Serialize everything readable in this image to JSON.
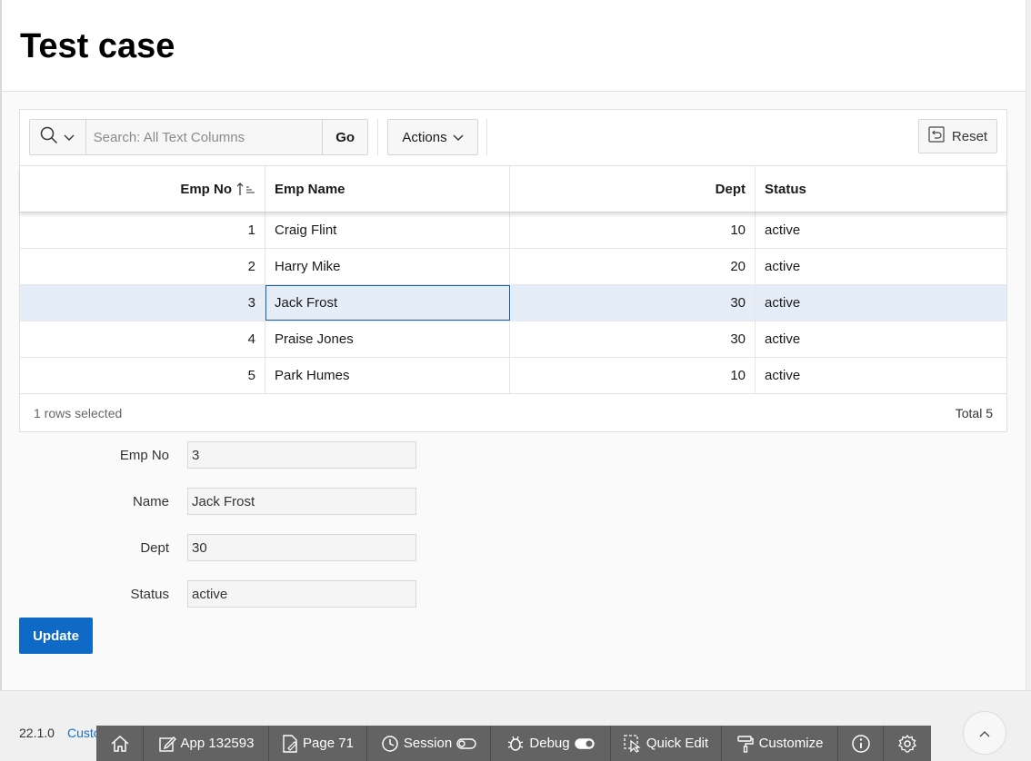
{
  "page": {
    "title": "Test case"
  },
  "toolbar": {
    "search_placeholder": "Search: All Text Columns",
    "go_label": "Go",
    "actions_label": "Actions",
    "reset_label": "Reset"
  },
  "grid": {
    "columns": [
      "Emp No",
      "Emp Name",
      "Dept",
      "Status"
    ],
    "rows": [
      {
        "emp_no": "1",
        "emp_name": "Craig Flint",
        "dept": "10",
        "status": "active"
      },
      {
        "emp_no": "2",
        "emp_name": "Harry Mike",
        "dept": "20",
        "status": "active"
      },
      {
        "emp_no": "3",
        "emp_name": "Jack Frost",
        "dept": "30",
        "status": "active"
      },
      {
        "emp_no": "4",
        "emp_name": "Praise Jones",
        "dept": "30",
        "status": "active"
      },
      {
        "emp_no": "5",
        "emp_name": "Park Humes",
        "dept": "10",
        "status": "active"
      }
    ],
    "selected_text": "1 rows selected",
    "total_text": "Total 5"
  },
  "form": {
    "emp_no": {
      "label": "Emp No",
      "value": "3"
    },
    "name": {
      "label": "Name",
      "value": "Jack Frost"
    },
    "dept": {
      "label": "Dept",
      "value": "30"
    },
    "status": {
      "label": "Status",
      "value": "active"
    },
    "update_label": "Update"
  },
  "footer": {
    "version": "22.1.0",
    "customize_link": "Custo"
  },
  "dev_toolbar": {
    "app": "App 132593",
    "page": "Page 71",
    "session": "Session",
    "debug": "Debug",
    "quick_edit": "Quick Edit",
    "customize": "Customize"
  },
  "colors": {
    "accent": "#0f6ac7",
    "selected_row": "#e5eef8",
    "dev_toolbar": "#636363"
  }
}
